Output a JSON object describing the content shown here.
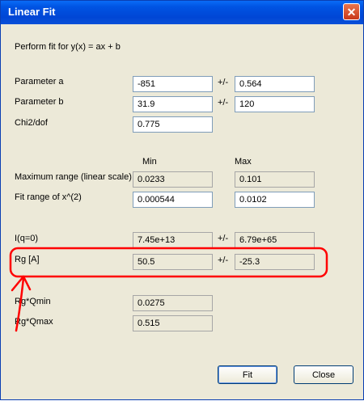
{
  "window": {
    "title": "Linear Fit"
  },
  "header": {
    "fit_text": "Perform fit for y(x) = ax + b"
  },
  "params": {
    "a": {
      "label": "Parameter a",
      "value": "-851",
      "error": "0.564"
    },
    "b": {
      "label": "Parameter b",
      "value": "31.9",
      "error": "120"
    },
    "chi2": {
      "label": "Chi2/dof",
      "value": "0.775"
    },
    "pm": "+/-"
  },
  "ranges": {
    "min_header": "Min",
    "max_header": "Max",
    "max_range": {
      "label": "Maximum range (linear scale)",
      "min": "0.0233",
      "max": "0.101"
    },
    "fit_range": {
      "label": "Fit range of x^(2)",
      "min": "0.000544",
      "max": "0.0102"
    }
  },
  "results": {
    "iq0": {
      "label": "I(q=0)",
      "value": "7.45e+13",
      "error": "6.79e+65"
    },
    "rg": {
      "label": "Rg [A]",
      "value": "50.5",
      "error": "-25.3"
    },
    "rg_qmin": {
      "label": "Rg*Qmin",
      "value": "0.0275"
    },
    "rg_qmax": {
      "label": "Rg*Qmax",
      "value": "0.515"
    }
  },
  "buttons": {
    "fit": "Fit",
    "close": "Close"
  },
  "annotation": {
    "color": "#ff0000"
  }
}
